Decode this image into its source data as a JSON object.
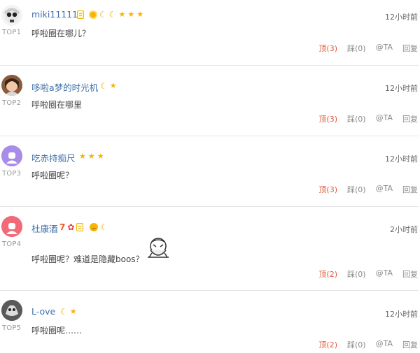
{
  "comments": [
    {
      "username": "miki11111",
      "top_label": "TOP1",
      "time": "12小时前",
      "text": "呼啦圈在哪儿？",
      "badges": [
        "doc-badge-icon",
        "sun-badge-icon",
        "moon-icon",
        "moon-icon",
        "star-icon",
        "star-icon",
        "star-icon"
      ],
      "actions": {
        "up": "顶(3)",
        "down": "踩(0)",
        "at": "@TA",
        "reply": "回复"
      }
    },
    {
      "username": "哆啦a梦的时光机",
      "top_label": "TOP2",
      "time": "12小时前",
      "text": "呼啦圈在哪里",
      "badges": [
        "moon-icon",
        "star-icon"
      ],
      "actions": {
        "up": "顶(3)",
        "down": "踩(0)",
        "at": "@TA",
        "reply": "回复"
      }
    },
    {
      "username": "吃赤持痴尺",
      "top_label": "TOP3",
      "time": "12小时前",
      "text": "呼啦圈呢？",
      "badges": [
        "star-icon",
        "star-icon",
        "star-icon"
      ],
      "actions": {
        "up": "顶(3)",
        "down": "踩(0)",
        "at": "@TA",
        "reply": "回复"
      }
    },
    {
      "username": "杜康酒",
      "top_label": "TOP4",
      "time": "2小时前",
      "text": "呼啦圈呢？难道是隐藏boos？",
      "badges": [
        "seven-badge-icon",
        "flower-badge-icon",
        "doc-badge-icon",
        "face-badge-icon",
        "moon-icon"
      ],
      "actions": {
        "up": "顶(2)",
        "down": "踩(0)",
        "at": "@TA",
        "reply": "回复"
      }
    },
    {
      "username": "L-ove",
      "top_label": "TOP5",
      "time": "12小时前",
      "text": "呼啦圈呢……",
      "badges": [
        "moon-icon",
        "star-icon"
      ],
      "actions": {
        "up": "顶(2)",
        "down": "踩(0)",
        "at": "@TA",
        "reply": "回复"
      }
    }
  ],
  "colors": {
    "username": "#3f6fa8",
    "up_action": "#e0583b",
    "badge_gold": "#f6b400"
  }
}
